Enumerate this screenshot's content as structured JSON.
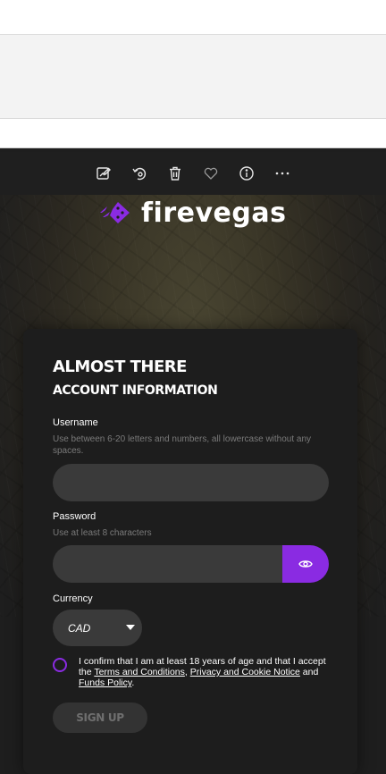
{
  "toolbar": {
    "icons": [
      "edit-image-icon",
      "rotate-icon",
      "delete-icon",
      "favorite-icon",
      "info-icon",
      "more-icon"
    ]
  },
  "brand": {
    "name": "firevegas",
    "accent": "#8a2be2"
  },
  "form": {
    "heading": "ALMOST THERE",
    "subheading": "ACCOUNT INFORMATION",
    "username": {
      "label": "Username",
      "hint": "Use between 6-20 letters and numbers, all lowercase without any spaces.",
      "value": ""
    },
    "password": {
      "label": "Password",
      "hint": "Use at least 8 characters",
      "value": ""
    },
    "currency": {
      "label": "Currency",
      "selected": "CAD"
    },
    "confirm": {
      "prefix": "I confirm that I am at least 18 years of age and that I accept the ",
      "terms": "Terms and Conditions",
      "comma": ", ",
      "privacy": "Privacy and Cookie Notice",
      "and": " and ",
      "funds": "Funds Policy",
      "suffix": "."
    },
    "submit_label": "SIGN UP"
  }
}
